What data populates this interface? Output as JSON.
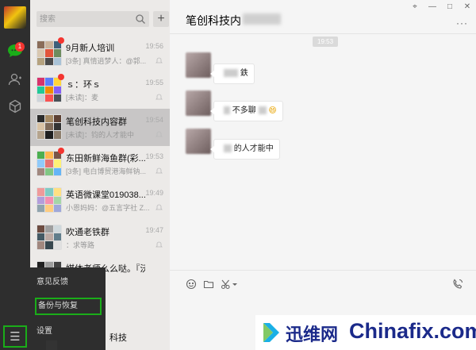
{
  "app": {
    "chat_badge": "1",
    "menu_icon": "☰"
  },
  "search": {
    "placeholder": "搜索",
    "add_label": "+"
  },
  "conversations": [
    {
      "name": "9月新人培训",
      "time": "19:56",
      "preview": "[3条] 真情逍梦人：@郭...",
      "unread": true,
      "active": false
    },
    {
      "name": "ｓ：环ｓ",
      "time": "19:55",
      "preview": "[未读]：麦",
      "unread": true,
      "active": false
    },
    {
      "name": "笔创科技内容群",
      "time": "19:54",
      "preview": "[未读]：钧的人才能中",
      "unread": false,
      "active": true
    },
    {
      "name": "东田新鲜海鱼群(彩...",
      "time": "19:53",
      "preview": "[3条] 电白博贸港海鲜钠...",
      "unread": true,
      "active": false
    },
    {
      "name": "英语微课堂019038...",
      "time": "19:49",
      "preview": "小恩妈妈：@五言字社 Z...",
      "unread": false,
      "active": false
    },
    {
      "name": "吹通老铁群",
      "time": "19:47",
      "preview": "：求等路",
      "unread": false,
      "active": false
    },
    {
      "name": "媒体老师么么哒。『沃菲』",
      "time": "",
      "preview": "",
      "unread": false,
      "active": false
    }
  ],
  "popup_menu": {
    "items": [
      "意见反馈",
      "备份与恢复",
      "设置"
    ],
    "highlighted": "备份与恢复"
  },
  "list_tail": {
    "name": "科技"
  },
  "chat": {
    "title": "笔创科技内",
    "more": "···",
    "window_controls": [
      "⌖",
      "—",
      "□",
      "✕"
    ],
    "timestamp": "19:53",
    "messages": [
      {
        "sender": "",
        "text": "鉄"
      },
      {
        "sender": "",
        "text": "不多聊",
        "emoji": "😄"
      },
      {
        "sender": "",
        "text": "的人才能中"
      }
    ]
  },
  "watermark": {
    "cn": "迅维网",
    "en": "Chinafix.com"
  },
  "colors": {
    "accent_green": "#1aad19",
    "badge_red": "#f43530",
    "sidebar_dark": "#2e2e2e",
    "watermark_blue": "#1b2a8a"
  }
}
